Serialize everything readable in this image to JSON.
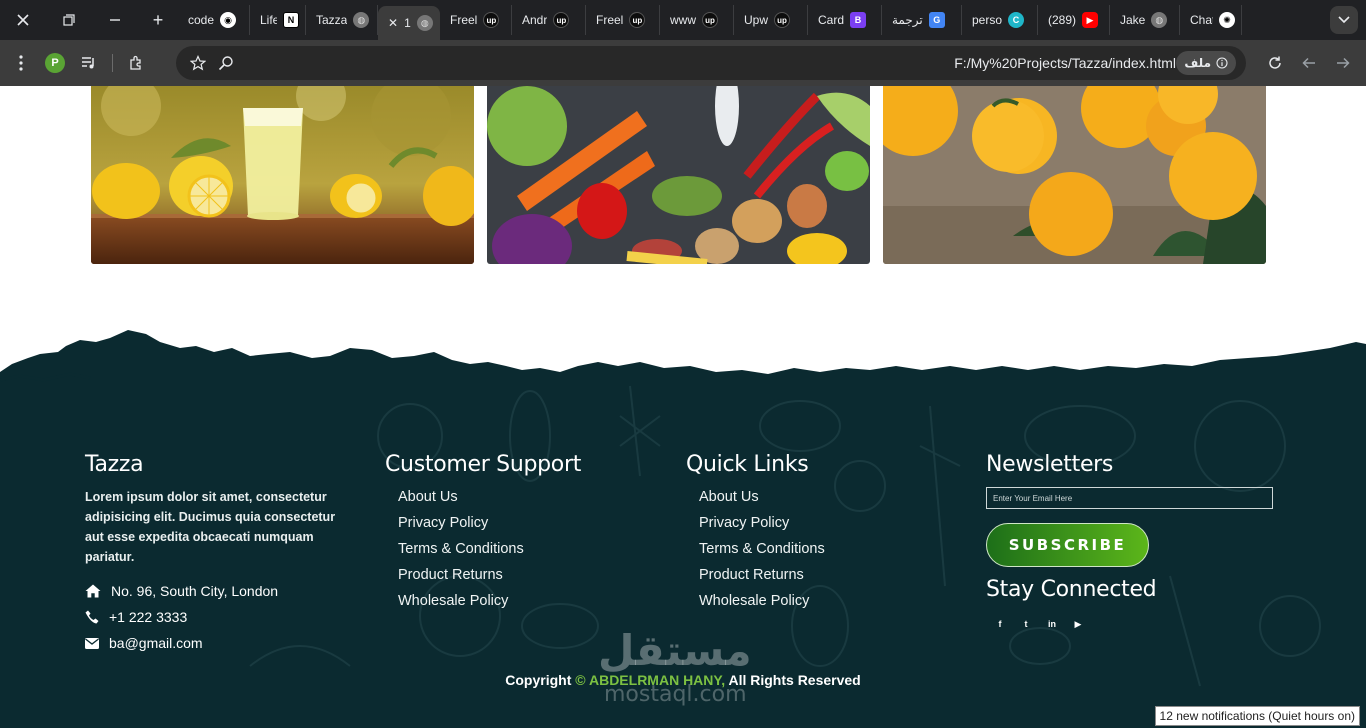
{
  "browser": {
    "tabs": [
      {
        "title": "code",
        "icon": "github-icon",
        "glyph": "◉",
        "cls": "gh"
      },
      {
        "title": "Life",
        "icon": "notion-icon",
        "glyph": "N",
        "cls": "notion"
      },
      {
        "title": "Tazza",
        "icon": "globe-icon",
        "glyph": "◍",
        "cls": "globe"
      },
      {
        "title": "1",
        "icon": "globe-icon",
        "glyph": "◍",
        "cls": "globe",
        "active": true
      },
      {
        "title": "Freel",
        "icon": "upwork-icon",
        "glyph": "up",
        "cls": "up"
      },
      {
        "title": "Andr",
        "icon": "upwork-icon",
        "glyph": "up",
        "cls": "up"
      },
      {
        "title": "Freel",
        "icon": "upwork-icon",
        "glyph": "up",
        "cls": "up"
      },
      {
        "title": "www",
        "icon": "upwork-icon",
        "glyph": "up",
        "cls": "up"
      },
      {
        "title": "Upw",
        "icon": "upwork-icon",
        "glyph": "up",
        "cls": "up"
      },
      {
        "title": "Card",
        "icon": "bootstrap-icon",
        "glyph": "B",
        "cls": "bs"
      },
      {
        "title": "ترجمة",
        "icon": "google-translate-icon",
        "glyph": "G",
        "cls": "gt"
      },
      {
        "title": "perso",
        "icon": "canva-icon",
        "glyph": "C",
        "cls": "canva"
      },
      {
        "title": "(289)",
        "icon": "youtube-icon",
        "glyph": "▶",
        "cls": "yt"
      },
      {
        "title": "Jake",
        "icon": "globe-icon",
        "glyph": "◍",
        "cls": "globe"
      },
      {
        "title": "Chat",
        "icon": "chatgpt-icon",
        "glyph": "✺",
        "cls": "gpt"
      }
    ],
    "profile_initial": "P",
    "url": "F:/My%20Projects/Tazza/index.html",
    "file_chip": "ملف"
  },
  "gallery": [
    {
      "name": "lemonade-image",
      "alt": "lemonade"
    },
    {
      "name": "vegetables-image",
      "alt": "vegetables"
    },
    {
      "name": "oranges-image",
      "alt": "oranges"
    }
  ],
  "footer": {
    "brand": {
      "title": "Tazza",
      "description": "Lorem ipsum dolor sit amet, consectetur adipisicing elit. Ducimus quia consectetur aut esse expedita obcaecati numquam pariatur.",
      "address": "No. 96, South City, London",
      "phone": "+1 222 3333",
      "email": "ba@gmail.com"
    },
    "support": {
      "title": "Customer Support",
      "links": [
        "About Us",
        "Privacy Policy",
        "Terms & Conditions",
        "Product Returns",
        "Wholesale Policy"
      ]
    },
    "quick": {
      "title": "Quick Links",
      "links": [
        "About Us",
        "Privacy Policy",
        "Terms & Conditions",
        "Product Returns",
        "Wholesale Policy"
      ]
    },
    "newsletter": {
      "title": "Newsletters",
      "placeholder": "Enter Your Email Here",
      "button": "SUBSCRIBE",
      "stay_title": "Stay Connected",
      "social": [
        {
          "name": "facebook-icon",
          "glyph": "f"
        },
        {
          "name": "twitter-icon",
          "glyph": "t"
        },
        {
          "name": "linkedin-icon",
          "glyph": "in"
        },
        {
          "name": "youtube-icon",
          "glyph": "▶"
        }
      ]
    },
    "copyright": {
      "prefix": "Copyright",
      "symbol": "©",
      "author": "ABDELRMAN HANY,",
      "suffix": "All Rights Reserved"
    },
    "watermark": {
      "arabic": "مستقل",
      "latin": "mostaql.com"
    }
  },
  "notification": "12 new notifications (Quiet hours on)",
  "colors": {
    "footer_bg": "#0b2a30",
    "accent": "#7cc142",
    "button_start": "#1d6f19",
    "button_end": "#5cb61a"
  }
}
